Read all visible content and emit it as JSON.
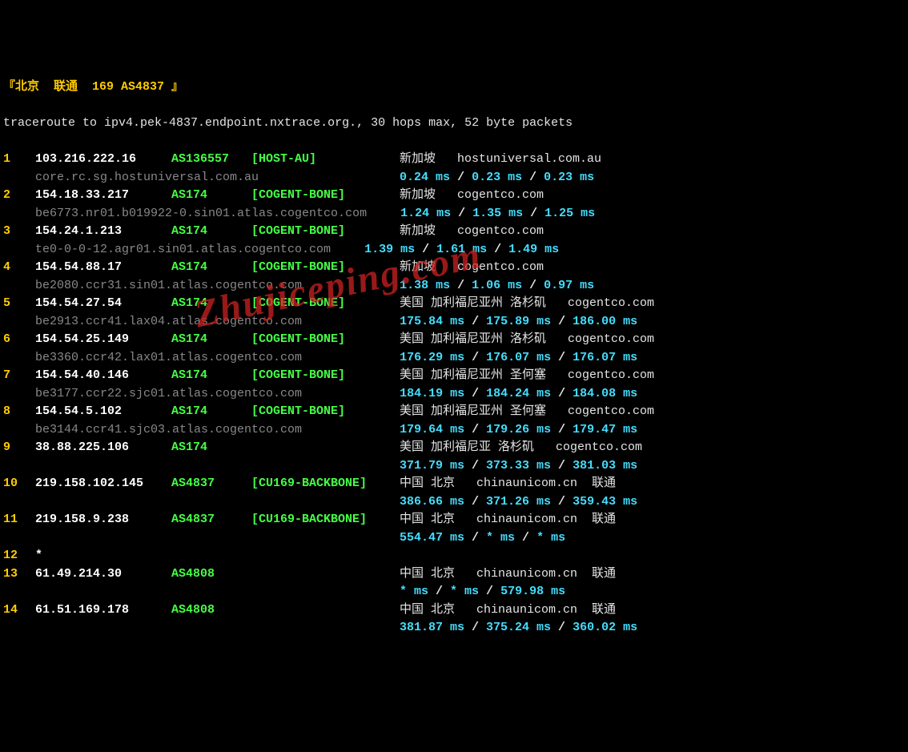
{
  "title": "『北京  联通  169 AS4837 』",
  "cmd": "traceroute to ipv4.pek-4837.endpoint.nxtrace.org., 30 hops max, 52 byte packets",
  "watermark": "Zhujiceping.com",
  "hops": [
    {
      "n": "1",
      "ip": "103.216.222.16",
      "asn": "AS136557",
      "org": "[HOST-AU]",
      "loc": "新加坡",
      "host": "hostuniversal.com.au",
      "rdns": "core.rc.sg.hostuniversal.com.au",
      "t1": "0.24 ms",
      "t2": "0.23 ms",
      "t3": "0.23 ms"
    },
    {
      "n": "2",
      "ip": "154.18.33.217",
      "asn": "AS174",
      "org": "[COGENT-BONE]",
      "loc": "新加坡",
      "host": "cogentco.com",
      "rdns": "be6773.nr01.b019922-0.sin01.atlas.cogentco.com",
      "t1": "1.24 ms",
      "t2": "1.35 ms",
      "t3": "1.25 ms",
      "rdns_long": true
    },
    {
      "n": "3",
      "ip": "154.24.1.213",
      "asn": "AS174",
      "org": "[COGENT-BONE]",
      "loc": "新加坡",
      "host": "cogentco.com",
      "rdns": "te0-0-0-12.agr01.sin01.atlas.cogentco.com",
      "t1": "1.39 ms",
      "t2": "1.61 ms",
      "t3": "1.49 ms",
      "rdns_long": true
    },
    {
      "n": "4",
      "ip": "154.54.88.17",
      "asn": "AS174",
      "org": "[COGENT-BONE]",
      "loc": "新加坡",
      "host": "cogentco.com",
      "rdns": "be2080.ccr31.sin01.atlas.cogentco.com",
      "t1": "1.38 ms",
      "t2": "1.06 ms",
      "t3": "0.97 ms"
    },
    {
      "n": "5",
      "ip": "154.54.27.54",
      "asn": "AS174",
      "org": "[COGENT-BONE]",
      "loc": "美国 加利福尼亚州 洛杉矶",
      "host": "cogentco.com",
      "rdns": "be2913.ccr41.lax04.atlas.cogentco.com",
      "t1": "175.84 ms",
      "t2": "175.89 ms",
      "t3": "186.00 ms"
    },
    {
      "n": "6",
      "ip": "154.54.25.149",
      "asn": "AS174",
      "org": "[COGENT-BONE]",
      "loc": "美国 加利福尼亚州 洛杉矶",
      "host": "cogentco.com",
      "rdns": "be3360.ccr42.lax01.atlas.cogentco.com",
      "t1": "176.29 ms",
      "t2": "176.07 ms",
      "t3": "176.07 ms"
    },
    {
      "n": "7",
      "ip": "154.54.40.146",
      "asn": "AS174",
      "org": "[COGENT-BONE]",
      "loc": "美国 加利福尼亚州 圣何塞",
      "host": "cogentco.com",
      "rdns": "be3177.ccr22.sjc01.atlas.cogentco.com",
      "t1": "184.19 ms",
      "t2": "184.24 ms",
      "t3": "184.08 ms"
    },
    {
      "n": "8",
      "ip": "154.54.5.102",
      "asn": "AS174",
      "org": "[COGENT-BONE]",
      "loc": "美国 加利福尼亚州 圣何塞",
      "host": "cogentco.com",
      "rdns": "be3144.ccr41.sjc03.atlas.cogentco.com",
      "t1": "179.64 ms",
      "t2": "179.26 ms",
      "t3": "179.47 ms"
    },
    {
      "n": "9",
      "ip": "38.88.225.106",
      "asn": "AS174",
      "org": "",
      "loc": "美国 加利福尼亚 洛杉矶",
      "host": "cogentco.com",
      "rdns": "",
      "t1": "371.79 ms",
      "t2": "373.33 ms",
      "t3": "381.03 ms"
    },
    {
      "n": "10",
      "ip": "219.158.102.145",
      "asn": "AS4837",
      "org": "[CU169-BACKBONE]",
      "loc": "中国 北京",
      "host": "chinaunicom.cn  联通",
      "rdns": "",
      "t1": "386.66 ms",
      "t2": "371.26 ms",
      "t3": "359.43 ms"
    },
    {
      "n": "11",
      "ip": "219.158.9.238",
      "asn": "AS4837",
      "org": "[CU169-BACKBONE]",
      "loc": "中国 北京",
      "host": "chinaunicom.cn  联通",
      "rdns": "",
      "t1": "554.47 ms",
      "t2": "* ms",
      "t3": "* ms"
    },
    {
      "n": "12",
      "ip": "*",
      "asn": "",
      "org": "",
      "loc": "",
      "host": "",
      "rdns": "",
      "t1": "",
      "t2": "",
      "t3": ""
    },
    {
      "n": "13",
      "ip": "61.49.214.30",
      "asn": "AS4808",
      "org": "",
      "loc": "中国 北京",
      "host": "chinaunicom.cn  联通",
      "rdns": "",
      "t1": "* ms",
      "t2": "* ms",
      "t3": "579.98 ms"
    },
    {
      "n": "14",
      "ip": "61.51.169.178",
      "asn": "AS4808",
      "org": "",
      "loc": "中国 北京",
      "host": "chinaunicom.cn  联通",
      "rdns": "",
      "t1": "381.87 ms",
      "t2": "375.24 ms",
      "t3": "360.02 ms"
    }
  ]
}
